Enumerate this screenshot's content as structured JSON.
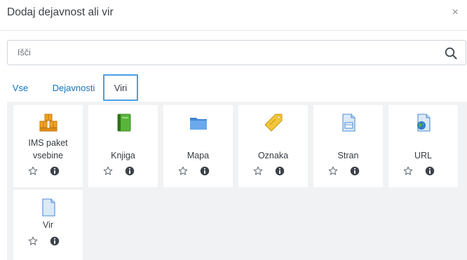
{
  "modal": {
    "title": "Dodaj dejavnost ali vir",
    "close_label": "×"
  },
  "search": {
    "placeholder": "Išči",
    "value": ""
  },
  "tabs": [
    {
      "label": "Vse"
    },
    {
      "label": "Dejavnosti"
    },
    {
      "label": "Viri",
      "active": true
    }
  ],
  "items": [
    {
      "label": "IMS paket vsebine",
      "icon": "ims-package-icon"
    },
    {
      "label": "Knjiga",
      "icon": "book-icon"
    },
    {
      "label": "Mapa",
      "icon": "folder-icon"
    },
    {
      "label": "Oznaka",
      "icon": "label-tag-icon"
    },
    {
      "label": "Stran",
      "icon": "page-icon"
    },
    {
      "label": "URL",
      "icon": "url-globe-icon"
    },
    {
      "label": "Vir",
      "icon": "file-icon"
    }
  ],
  "colors": {
    "link": "#1075c2",
    "active_tab_border": "#4a9ee1",
    "grid_background": "#f1f2f3"
  }
}
